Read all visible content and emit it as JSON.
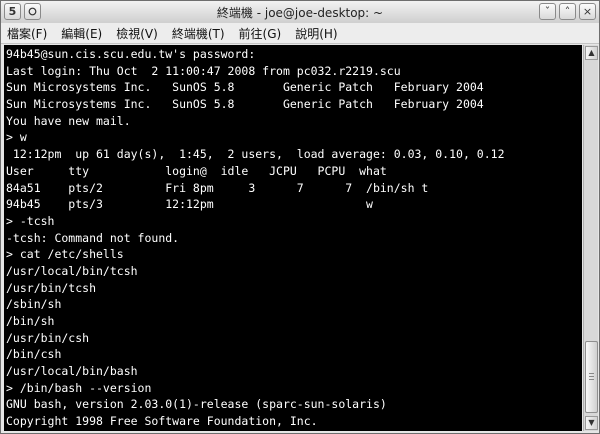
{
  "window": {
    "title": "終端機 - joe@joe-desktop: ~",
    "menu_button": "5",
    "minimize": "ˇ",
    "maximize": "˄",
    "close": "×"
  },
  "menu": {
    "items": [
      {
        "label": "檔案(F)"
      },
      {
        "label": "編輯(E)"
      },
      {
        "label": "檢視(V)"
      },
      {
        "label": "終端機(T)"
      },
      {
        "label": "前往(G)"
      },
      {
        "label": "說明(H)"
      }
    ]
  },
  "terminal": {
    "lines": [
      "94b45@sun.cis.scu.edu.tw's password:",
      "Last login: Thu Oct  2 11:00:47 2008 from pc032.r2219.scu",
      "Sun Microsystems Inc.   SunOS 5.8       Generic Patch   February 2004",
      "Sun Microsystems Inc.   SunOS 5.8       Generic Patch   February 2004",
      "You have new mail.",
      "> w",
      " 12:12pm  up 61 day(s),  1:45,  2 users,  load average: 0.03, 0.10, 0.12",
      "User     tty           login@  idle   JCPU   PCPU  what",
      "84a51    pts/2         Fri 8pm     3      7      7  /bin/sh t",
      "94b45    pts/3         12:12pm                      w",
      "> -tcsh",
      "-tcsh: Command not found.",
      "> cat /etc/shells",
      "/usr/local/bin/tcsh",
      "/usr/bin/tcsh",
      "/sbin/sh",
      "/bin/sh",
      "/usr/bin/csh",
      "/bin/csh",
      "/usr/local/bin/bash",
      "> /bin/bash --version",
      "GNU bash, version 2.03.0(1)-release (sparc-sun-solaris)",
      "Copyright 1998 Free Software Foundation, Inc."
    ],
    "prompt": ">",
    "colors": {
      "background": "#000000",
      "foreground": "#ffffff",
      "cursor": "#00ff00"
    }
  }
}
